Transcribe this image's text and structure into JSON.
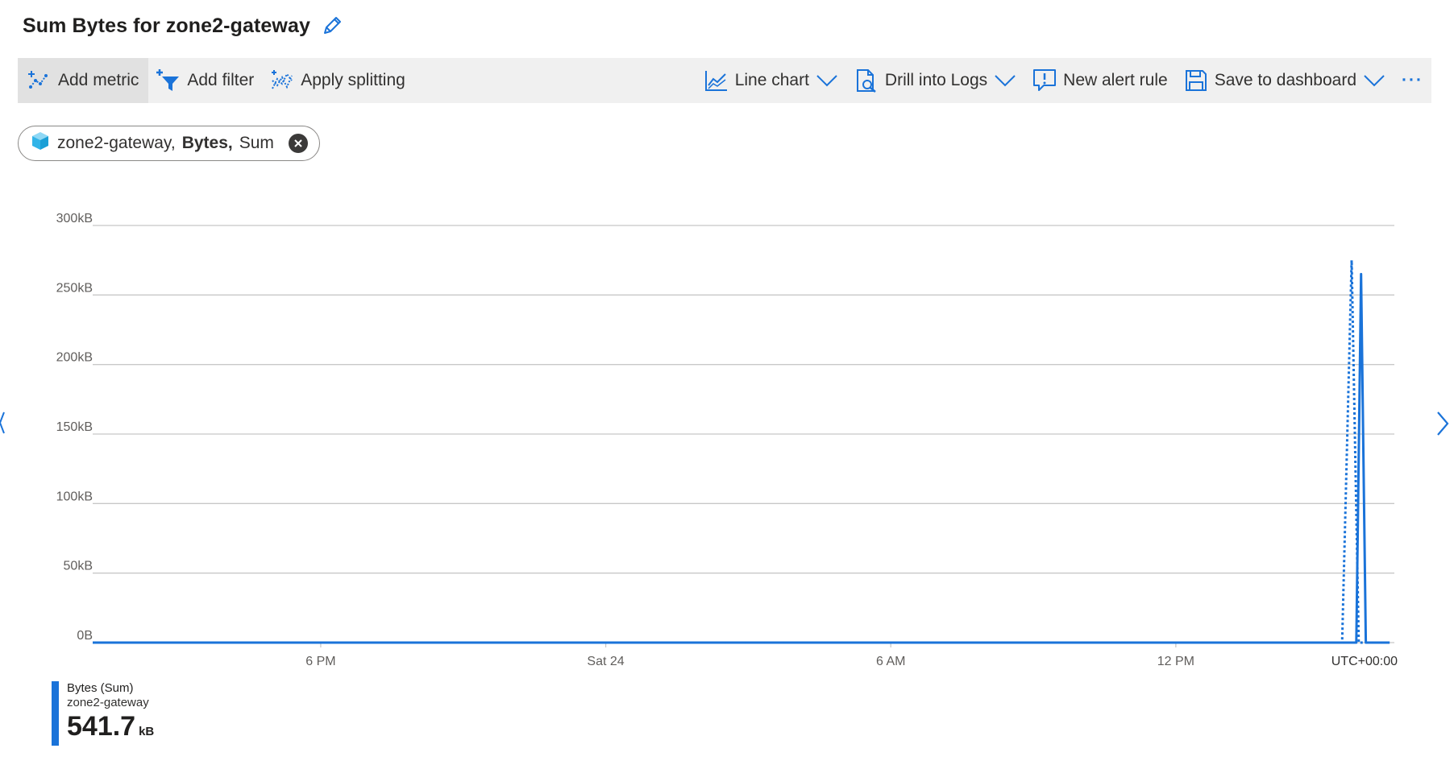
{
  "title": "Sum Bytes for zone2-gateway",
  "toolbar": {
    "add_metric": "Add metric",
    "add_filter": "Add filter",
    "apply_splitting": "Apply splitting",
    "line_chart": "Line chart",
    "drill_into_logs": "Drill into Logs",
    "new_alert_rule": "New alert rule",
    "save_to_dashboard": "Save to dashboard",
    "more": "···"
  },
  "metric_pill": {
    "resource": "zone2-gateway,",
    "metric": "Bytes,",
    "aggregation": "Sum"
  },
  "colors": {
    "accent": "#1a73d9",
    "toolbar_bg": "#f0f0f0",
    "grid": "#c8c8c8"
  },
  "chart_data": {
    "type": "line",
    "y_ticks": [
      "0B",
      "50kB",
      "100kB",
      "150kB",
      "200kB",
      "250kB",
      "300kB"
    ],
    "y_tick_values": [
      0,
      50,
      100,
      150,
      200,
      250,
      300
    ],
    "y_unit": "kB",
    "ylim": [
      0,
      300
    ],
    "x_ticks": [
      "6 PM",
      "Sat 24",
      "6 AM",
      "12 PM"
    ],
    "x_tick_hours": [
      18,
      24,
      30,
      36
    ],
    "x_range_hours": [
      13.2,
      40.6
    ],
    "timezone_label": "UTC+00:00",
    "grid": true,
    "series": [
      {
        "name": "Bytes (Sum)",
        "style": "solid",
        "points": [
          [
            13.2,
            0
          ],
          [
            39.6,
            0
          ],
          [
            39.8,
            0
          ],
          [
            39.9,
            265
          ],
          [
            40.0,
            0
          ],
          [
            40.5,
            0
          ]
        ]
      },
      {
        "style": "dotted",
        "points": [
          [
            13.2,
            0
          ],
          [
            39.3,
            0
          ],
          [
            39.5,
            0
          ],
          [
            39.7,
            275
          ],
          [
            39.85,
            0
          ],
          [
            40.5,
            0
          ]
        ]
      }
    ]
  },
  "legend": {
    "metric": "Bytes (Sum)",
    "resource": "zone2-gateway",
    "value": "541.7",
    "unit": "kB"
  }
}
